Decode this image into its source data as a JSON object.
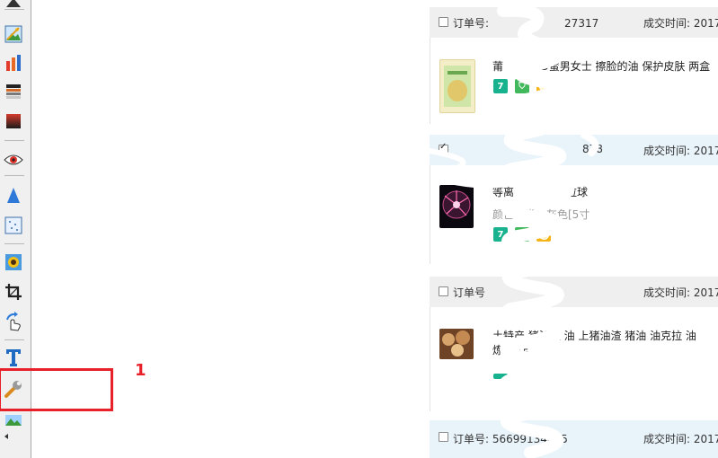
{
  "toolbar": {
    "tools": [
      {
        "icon": "image-icon"
      },
      {
        "icon": "bar-chart-icon"
      },
      {
        "icon": "levels-icon"
      },
      {
        "icon": "gradient-icon"
      },
      {
        "icon": "eye-icon"
      },
      {
        "icon": "sharpen-icon"
      },
      {
        "icon": "noise-icon"
      },
      {
        "icon": "sunflower-icon"
      },
      {
        "icon": "crop-icon"
      },
      {
        "icon": "rotate-icon"
      },
      {
        "icon": "text-icon"
      },
      {
        "icon": "wrench-icon"
      },
      {
        "icon": "landscape-icon"
      }
    ]
  },
  "annotation": {
    "number": "1",
    "color": "#e8202a"
  },
  "orders": [
    {
      "order_no": "订单号:",
      "order_no_tail": "27317",
      "time_label": "成交时间: 2017",
      "checked": false,
      "title": "莆",
      "title_tail": "OD蜜男女士 擦脸的油 保护皮肤 两盒",
      "spec": ""
    },
    {
      "order_no": "",
      "order_no_tail": "878",
      "time_label": "成交时间: 2017",
      "checked": true,
      "title": "等离",
      "title_tail": "斯拉球",
      "spec": "颜色分类：灰色[5寸"
    },
    {
      "order_no": "订单号",
      "order_no_tail": "",
      "time_label": "成交时间: 2017",
      "checked": false,
      "title": "土特产 猪油渣 油 上猪油渣 猪油 油克拉 油",
      "title_line2": "炼油 炸",
      "spec": ""
    },
    {
      "order_no": "订单号: 56699134685",
      "order_no_tail": "",
      "time_label": "成交时间: 2017",
      "checked": false,
      "title": "",
      "spec": ""
    }
  ],
  "badges": {
    "seven": "7"
  },
  "colors": {
    "badge_green": "#19b28e",
    "badge_shield": "#41b85c",
    "badge_gold": "#f7b418",
    "header_blue": "#e8f3fa",
    "header_gray": "#efefef"
  }
}
